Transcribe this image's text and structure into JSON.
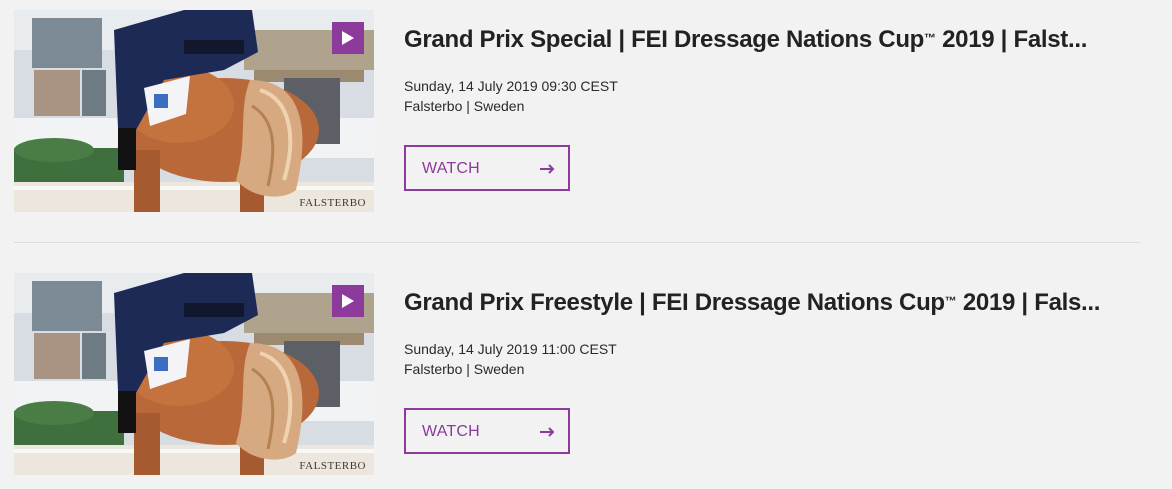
{
  "events": [
    {
      "title_main": "Grand Prix Special | FEI Dressage Nations Cup",
      "title_tm": "™",
      "title_rest": " 2019 | Falst...",
      "date": "Sunday, 14 July 2019 09:30 CEST",
      "location": "Falsterbo | Sweden",
      "watch_label": "WATCH",
      "thumbnail_watermark": "FALSTERBO",
      "thumbnail_icon": "play-icon"
    },
    {
      "title_main": "Grand Prix Freestyle | FEI Dressage Nations Cup",
      "title_tm": "™",
      "title_rest": " 2019 | Fals...",
      "date": "Sunday, 14 July 2019 11:00 CEST",
      "location": "Falsterbo | Sweden",
      "watch_label": "WATCH",
      "thumbnail_watermark": "FALSTERBO",
      "thumbnail_icon": "play-icon"
    }
  ],
  "colors": {
    "accent": "#8c3a9b",
    "background": "#f2f2f2",
    "text": "#222222",
    "divider": "#dcdcdc"
  }
}
